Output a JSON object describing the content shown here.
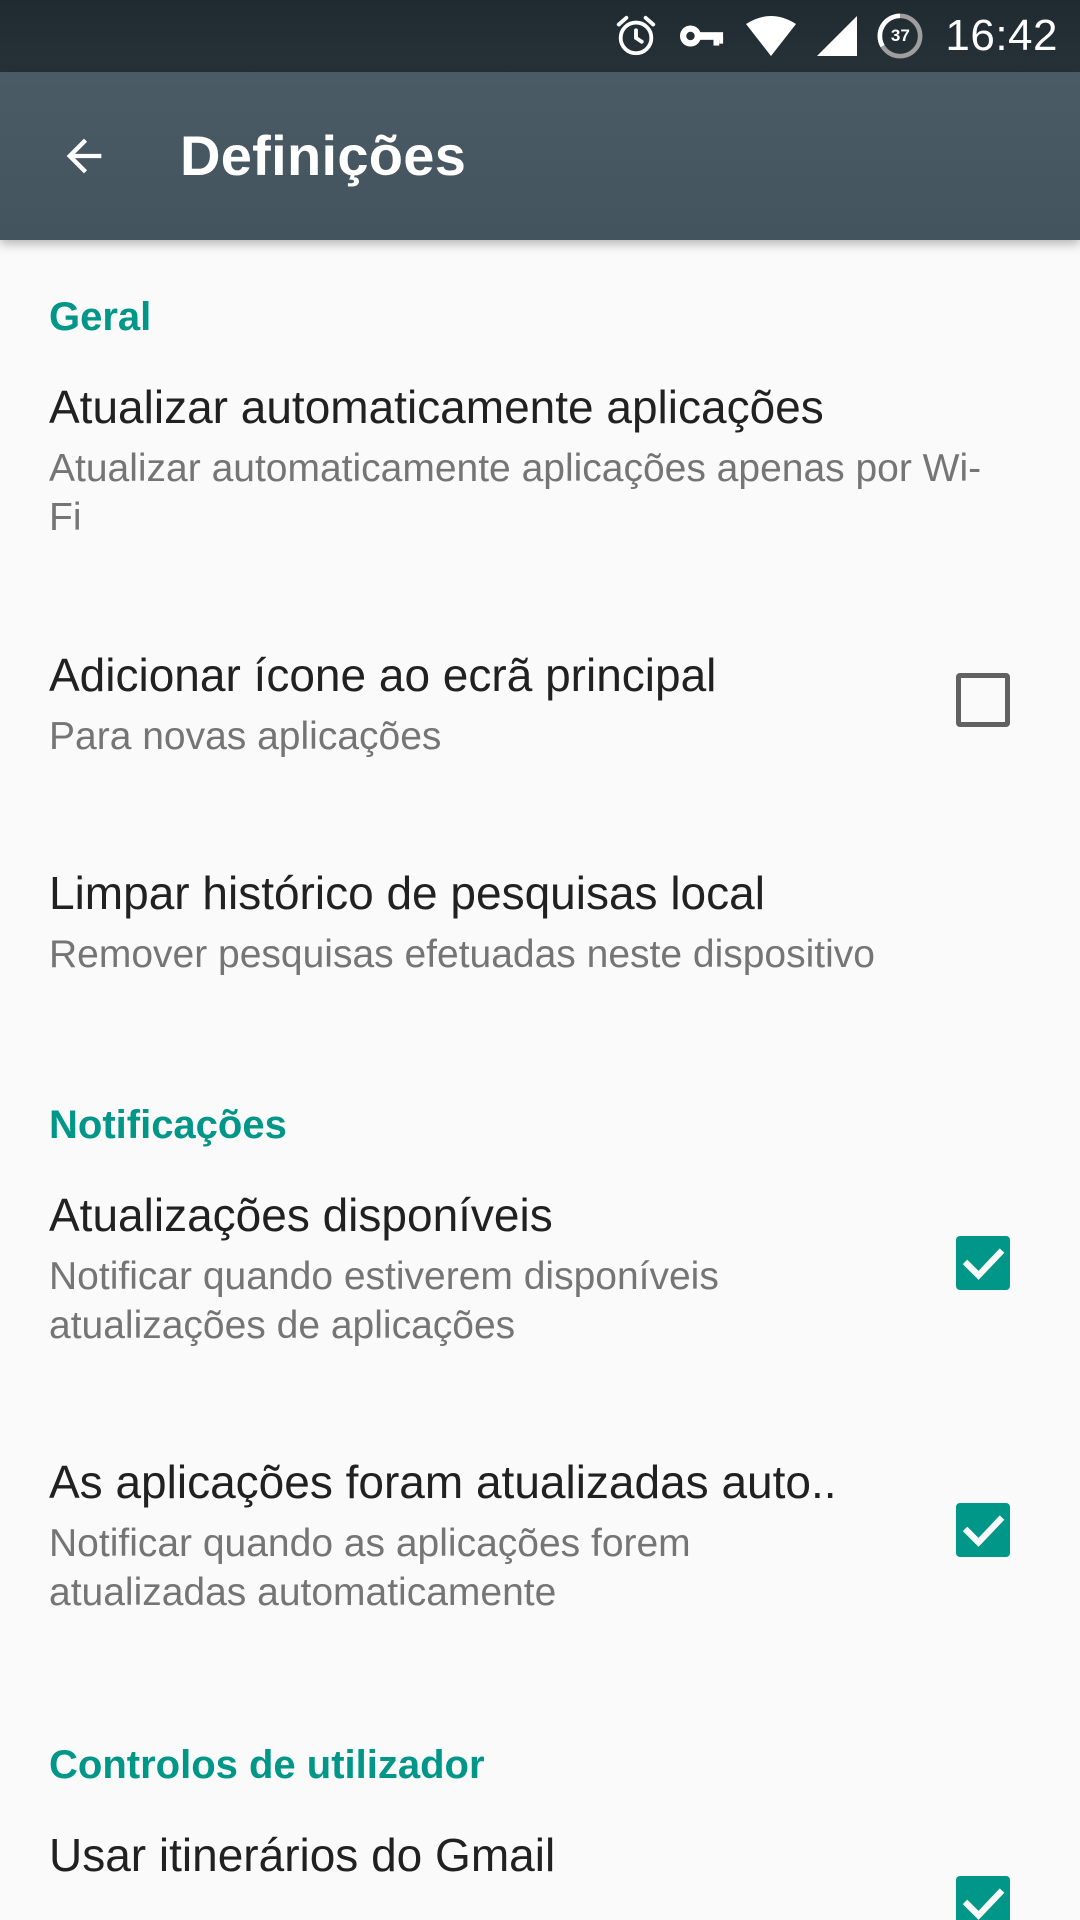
{
  "status_bar": {
    "time": "16:42",
    "battery_level": "37",
    "icons": [
      "alarm-icon",
      "vpn-key-icon",
      "wifi-icon",
      "cellular-signal-icon",
      "battery-icon"
    ]
  },
  "app_bar": {
    "back_icon": "arrow-back-icon",
    "title": "Definições"
  },
  "sections": {
    "general": {
      "header": "Geral",
      "auto_update": {
        "title": "Atualizar automaticamente aplicações",
        "summary": "Atualizar automaticamente aplicações apenas por Wi-Fi"
      },
      "add_icon": {
        "title": "Adicionar ícone ao ecrã principal",
        "summary": "Para novas aplicações",
        "checked": false
      },
      "clear_history": {
        "title": "Limpar histórico de pesquisas local",
        "summary": "Remover pesquisas efetuadas neste dispositivo"
      }
    },
    "notifications": {
      "header": "Notificações",
      "updates_available": {
        "title": "Atualizações disponíveis",
        "summary": "Notificar quando estiverem disponíveis atualizações de aplicações",
        "checked": true
      },
      "auto_updated": {
        "title": "As aplicações foram atualizadas auto..",
        "summary": "Notificar quando as aplicações forem atualizadas automaticamente",
        "checked": true
      }
    },
    "user_controls": {
      "header": "Controlos de utilizador",
      "gmail_itineraries": {
        "title": "Usar itinerários do Gmail",
        "checked": true
      }
    }
  },
  "colors": {
    "accent": "#009688",
    "app_bar": "#455a64",
    "status_bar": "#263238",
    "background": "#fafafa",
    "primary_text": "#212121",
    "secondary_text": "#757575"
  }
}
